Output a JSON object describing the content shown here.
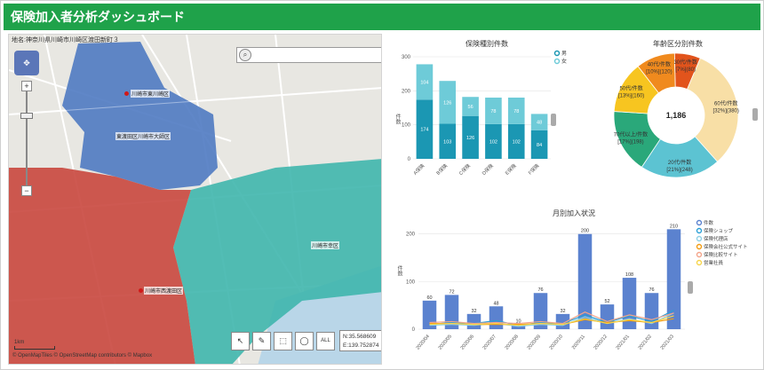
{
  "header": {
    "title": "保険加入者分析ダッシュボード"
  },
  "map": {
    "address": "地名:神奈川県川崎市川崎区渡田新町３",
    "zoom_plus": "+",
    "zoom_minus": "−",
    "labels": [
      {
        "text": "川崎市東川崎区"
      },
      {
        "text": "東渡田区川崎市大師区"
      },
      {
        "text": "川崎市西渡田区"
      },
      {
        "text": "川崎市幸区"
      }
    ],
    "scale_label": "1km",
    "copyright": "© OpenMapTiles © OpenStreetMap contributors © Mapbox",
    "coords": {
      "n": "N:35.568609",
      "e": "E:139.752874"
    },
    "tool_labels": [
      "↖",
      "✎",
      "⬚",
      "◯",
      "ALL"
    ]
  },
  "colors": {
    "header": "#1fa24a",
    "bar_dark": "#1b97b3",
    "bar_light": "#6ecbd8",
    "region_red": "#c9473e",
    "region_blue": "#4f7ac2",
    "region_teal": "#3fb6ad"
  },
  "chart_data": [
    {
      "type": "bar",
      "title": "保険種別件数",
      "ylabel": "件数",
      "categories": [
        "A保険",
        "B保険",
        "C保険",
        "D保険",
        "E保険",
        "F保険"
      ],
      "series": [
        {
          "name": "男",
          "values": [
            174,
            103,
            126,
            102,
            102,
            84
          ],
          "color": "#1b97b3"
        },
        {
          "name": "女",
          "values": [
            104,
            126,
            56,
            78,
            78,
            48
          ],
          "color": "#6ecbd8"
        }
      ],
      "ylim": [
        0,
        300
      ],
      "yticks": [
        0,
        100,
        200,
        300
      ]
    },
    {
      "type": "pie",
      "title": "年齢区分別件数",
      "total": "1,186",
      "slices": [
        {
          "label": "60代/件数",
          "detail": "[32%](380)",
          "value": 380,
          "color": "#f8dfa6"
        },
        {
          "label": "20代/件数",
          "detail": "[21%](248)",
          "value": 248,
          "color": "#5cc3d2"
        },
        {
          "label": "70代以上/件数",
          "detail": "[17%](198)",
          "value": 198,
          "color": "#2aa87a"
        },
        {
          "label": "50代/件数",
          "detail": "[13%](160)",
          "value": 160,
          "color": "#f7c520"
        },
        {
          "label": "40代/件数",
          "detail": "[10%](120)",
          "value": 120,
          "color": "#f08a1e"
        },
        {
          "label": "30代/件数",
          "detail": "[7%](80)",
          "value": 80,
          "color": "#e2541c"
        }
      ]
    },
    {
      "type": "bar",
      "title": "月別加入状況",
      "ylabel": "件数",
      "categories": [
        "2020/04",
        "2020/05",
        "2020/06",
        "2020/07",
        "2020/08",
        "2020/09",
        "2020/10",
        "2020/11",
        "2020/12",
        "2021/01",
        "2021/02",
        "2021/03"
      ],
      "values": [
        60,
        72,
        32,
        48,
        10,
        76,
        32,
        200,
        52,
        108,
        76,
        210
      ],
      "bar_name": "件数",
      "bar_color": "#5b82cf",
      "ylim": [
        0,
        220
      ],
      "yticks": [
        0,
        100,
        200
      ],
      "legend": [
        "件数",
        "保険ショップ",
        "保険代理店",
        "保険会社公式サイト",
        "保険比較サイト",
        "営業社員"
      ],
      "lines": [
        {
          "name": "保険ショップ",
          "color": "#2a9fd6",
          "values": [
            10,
            14,
            12,
            18,
            8,
            14,
            12,
            30,
            14,
            28,
            16,
            40
          ]
        },
        {
          "name": "保険代理店",
          "color": "#8fd0e6",
          "values": [
            8,
            10,
            8,
            12,
            6,
            10,
            8,
            26,
            12,
            22,
            12,
            34
          ]
        },
        {
          "name": "保険会社公式サイト",
          "color": "#f39c12",
          "values": [
            12,
            12,
            10,
            10,
            10,
            12,
            10,
            20,
            14,
            18,
            14,
            22
          ]
        },
        {
          "name": "保険比較サイト",
          "color": "#f4a48a",
          "values": [
            14,
            16,
            12,
            14,
            12,
            16,
            12,
            36,
            16,
            30,
            20,
            34
          ]
        },
        {
          "name": "営業社員",
          "color": "#f7d54a",
          "values": [
            10,
            12,
            10,
            12,
            8,
            12,
            10,
            22,
            12,
            20,
            14,
            28
          ]
        }
      ]
    }
  ]
}
